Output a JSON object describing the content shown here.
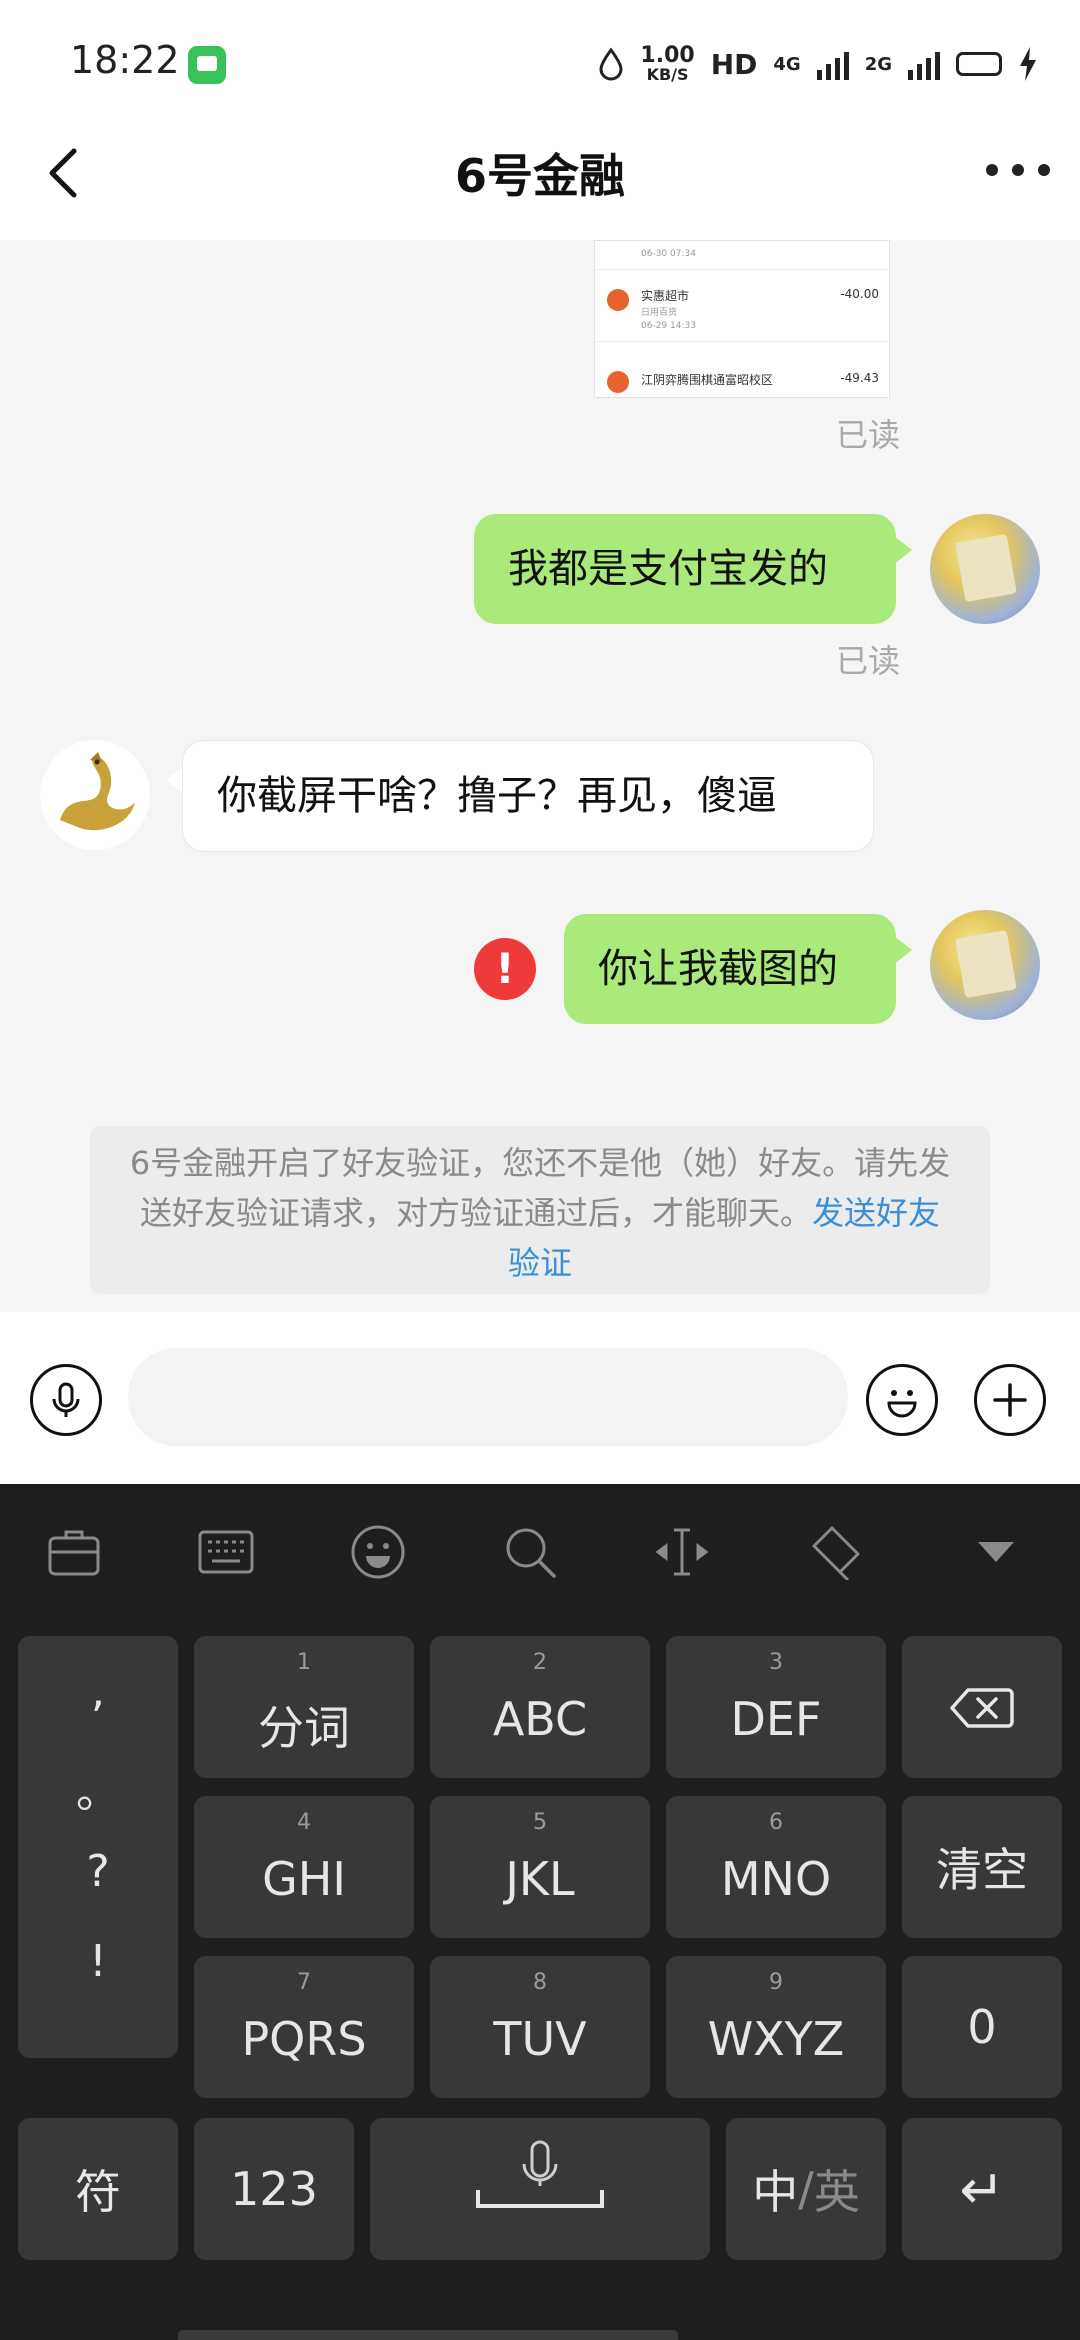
{
  "status_bar": {
    "time": "18:22",
    "speed_value": "1.00",
    "speed_unit": "KB/S",
    "hd": "HD",
    "net1": "4G",
    "net2": "2G"
  },
  "nav": {
    "title": "6号金融"
  },
  "screenshot_thumb": {
    "rows": [
      {
        "name": "",
        "sub": "06-30 07:34",
        "amount": ""
      },
      {
        "name": "实惠超市",
        "sub": "日用百货",
        "date": "06-29 14:33",
        "amount": "-40.00"
      },
      {
        "name": "江阴弈腾围棋通富昭校区",
        "sub": "",
        "amount": "-49.43"
      }
    ]
  },
  "messages": [
    {
      "type": "read",
      "text": "已读"
    },
    {
      "type": "out",
      "text": "我都是支付宝发的"
    },
    {
      "type": "read",
      "text": "已读"
    },
    {
      "type": "in",
      "text": "你截屏干啥？撸子？再见，傻逼"
    },
    {
      "type": "out",
      "text": "你让我截图的",
      "error": true
    }
  ],
  "notice": {
    "text": "6号金融开启了好友验证，您还不是他（她）好友。请先发送好友验证请求，对方验证通过后，才能聊天。",
    "link": "发送好友验证"
  },
  "input": {
    "placeholder": ""
  },
  "keyboard": {
    "punct": [
      ",",
      "。",
      "?",
      "!"
    ],
    "keys": [
      {
        "num": "1",
        "label": "分词"
      },
      {
        "num": "2",
        "label": "ABC"
      },
      {
        "num": "3",
        "label": "DEF"
      },
      {
        "num": "4",
        "label": "GHI"
      },
      {
        "num": "5",
        "label": "JKL"
      },
      {
        "num": "6",
        "label": "MNO"
      },
      {
        "num": "7",
        "label": "PQRS"
      },
      {
        "num": "8",
        "label": "TUV"
      },
      {
        "num": "9",
        "label": "WXYZ"
      }
    ],
    "clear": "清空",
    "zero": "0",
    "symbols": "符",
    "numbers": "123",
    "lang_cn": "中",
    "lang_sep": "/",
    "lang_en": "英",
    "enter": "↵"
  },
  "colors": {
    "out_bubble": "#a9ea7a",
    "in_bubble": "#ffffff",
    "link": "#3b8fd9",
    "error": "#ee3a3a",
    "keyboard_bg": "#1e1e1e",
    "key_bg": "#383838"
  },
  "icons": [
    "back-icon",
    "more-icon",
    "voice-icon",
    "emoji-icon",
    "plus-icon",
    "toolbox-icon",
    "keyboard-icon",
    "emoticon-icon",
    "search-icon",
    "cursor-icon",
    "skin-icon",
    "collapse-icon",
    "backspace-icon",
    "mic-icon",
    "error-icon"
  ]
}
